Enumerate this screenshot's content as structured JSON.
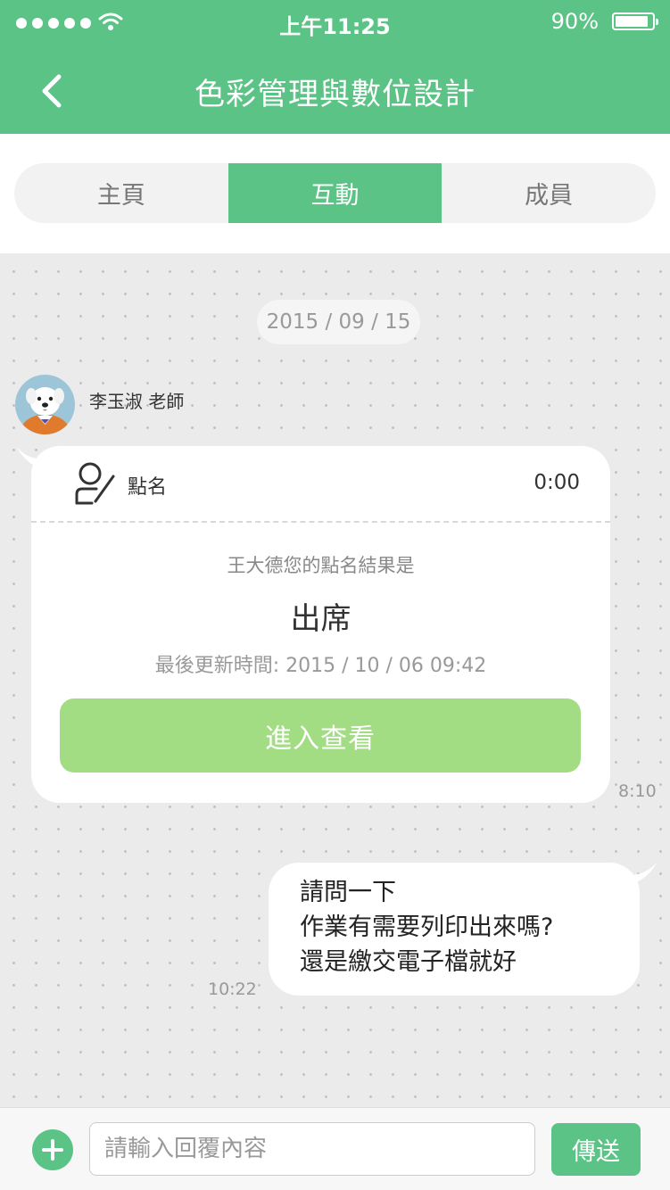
{
  "status_bar": {
    "time": "上午11:25",
    "battery_percent": "90%",
    "battery_level": 0.9,
    "icons": [
      "signal-dots-icon",
      "wifi-icon",
      "battery-icon"
    ]
  },
  "header": {
    "title": "色彩管理與數位設計",
    "back_icon": "chevron-left-icon"
  },
  "tabs": [
    {
      "label": "主頁",
      "active": false
    },
    {
      "label": "互動",
      "active": true
    },
    {
      "label": "成員",
      "active": false
    }
  ],
  "chat": {
    "date": "2015 / 09 / 15",
    "sender": {
      "name": "李玉淑  老師",
      "avatar": "dog-avatar"
    },
    "attendance_card": {
      "icon": "person-check-icon",
      "label": "點名",
      "timer": "0:00",
      "result_prompt": "王大德您的點名結果是",
      "result": "出席",
      "last_updated": "最後更新時間: 2015 / 10 / 06 09:42",
      "button_label": "進入查看"
    },
    "card_time": "8:10",
    "my_message": {
      "lines": [
        "請問一下",
        "作業有需要列印出來嗎?",
        "還是繳交電子檔就好"
      ],
      "time": "10:22"
    }
  },
  "input_bar": {
    "add_icon": "plus-circle-icon",
    "placeholder": "請輸入回覆內容",
    "send_label": "傳送"
  },
  "colors": {
    "brand_green": "#5bc385",
    "button_green": "#a2dc83",
    "chat_background": "#ebebeb"
  }
}
